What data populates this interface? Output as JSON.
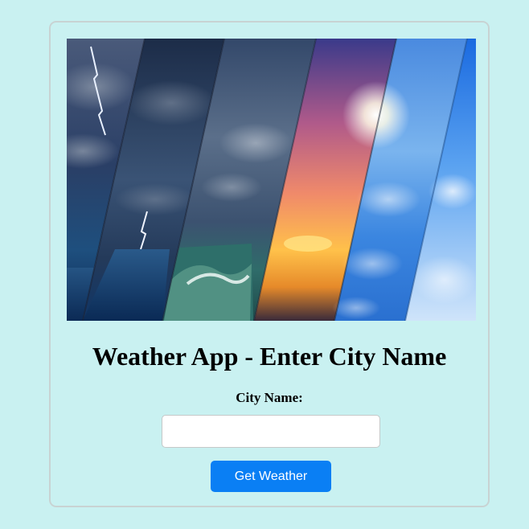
{
  "page": {
    "title": "Weather App - Enter City Name",
    "city_label": "City Name:",
    "city_input": {
      "value": "",
      "placeholder": ""
    },
    "button_label": "Get Weather"
  },
  "hero": {
    "semantic": "weather-collage-image",
    "panels": [
      "thunderstorm",
      "lightning-sea",
      "storm-waves",
      "sunset",
      "sunny-sky",
      "clear-sky"
    ]
  },
  "colors": {
    "page_background": "#c9f1f1",
    "card_border": "#c8d3d3",
    "button": "#0a7ff4",
    "button_text": "#ffffff"
  }
}
